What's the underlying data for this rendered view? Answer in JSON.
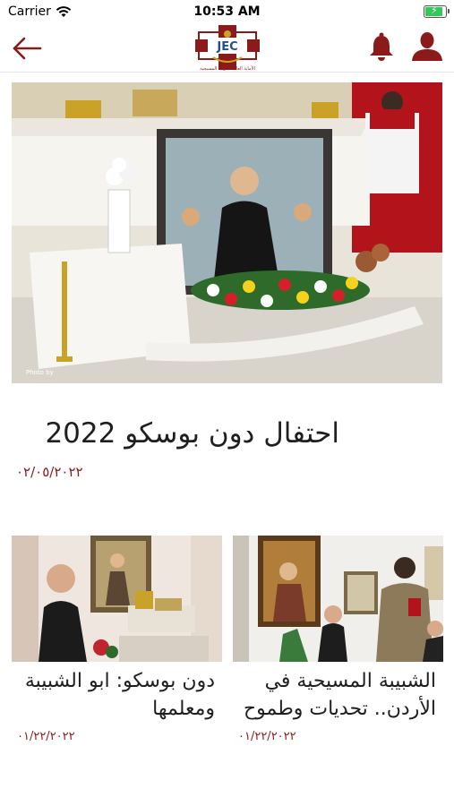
{
  "status_bar": {
    "carrier": "Carrier",
    "time": "10:53 AM"
  },
  "header": {
    "back_icon": "arrow-left-icon",
    "logo_text": "JEC",
    "logo_caption": "الأمانة العامة للتربية المسيحية",
    "bell_icon": "bell-icon",
    "user_icon": "user-icon",
    "accent_color": "#8b1a1a"
  },
  "featured": {
    "image_caption": "Photo by",
    "title": "احتفال دون بوسكو 2022",
    "date": "٠٢/٠٥/٢٠٢٢"
  },
  "articles": [
    {
      "title": "دون بوسكو: ابو الشبيبة ومعلمها",
      "date": "٠١/٢٢/٢٠٢٢"
    },
    {
      "title": "الشبيبة المسيحية في الأردن.. تحديات وطموح",
      "date": "٠١/٢٢/٢٠٢٢"
    }
  ]
}
